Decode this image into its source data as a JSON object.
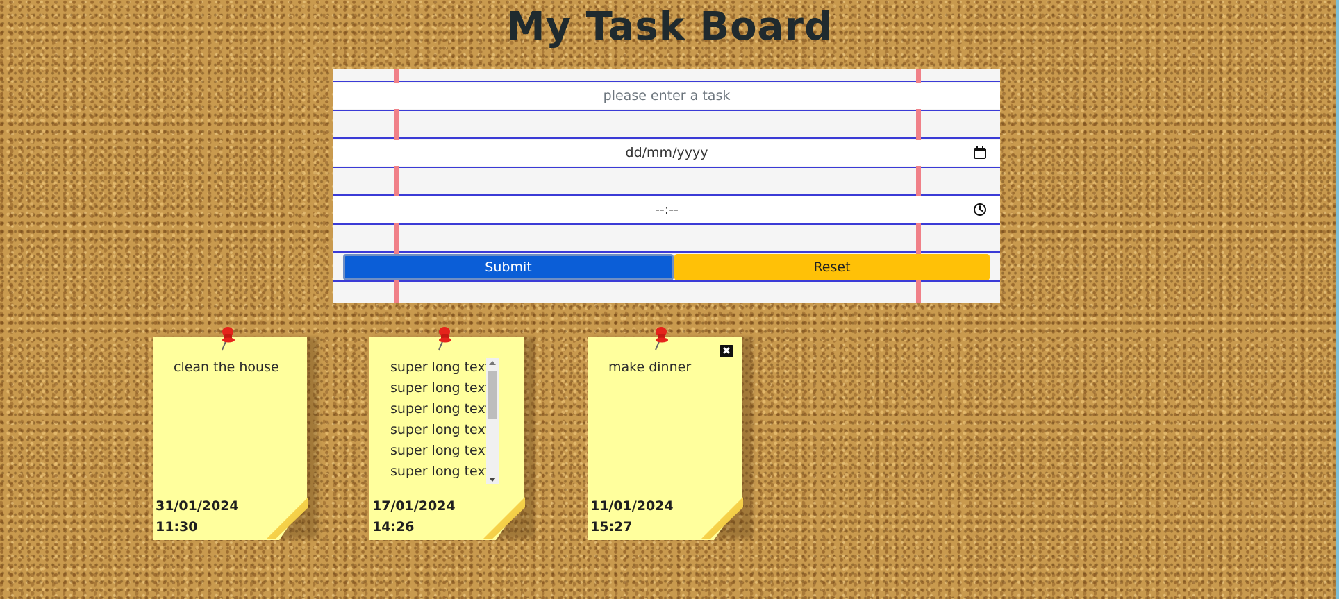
{
  "page": {
    "title": "My Task Board"
  },
  "form": {
    "task_placeholder": "please enter a task",
    "date_placeholder": "dd/mm/yyyy",
    "time_placeholder": "--:--",
    "submit_label": "Submit",
    "reset_label": "Reset",
    "date_icon": "calendar-icon",
    "time_icon": "clock-icon"
  },
  "notes": [
    {
      "text": "clean the house",
      "date": "31/01/2024",
      "time": "11:30"
    },
    {
      "lines": [
        "super long text",
        "super long text",
        "super long text",
        "super long text",
        "super long text",
        "super long text"
      ],
      "date": "17/01/2024",
      "time": "14:26"
    },
    {
      "text": "make dinner",
      "date": "11/01/2024",
      "time": "15:27",
      "close_icon": "close-icon"
    }
  ],
  "colors": {
    "submit": "#0b5ed7",
    "reset": "#ffc107",
    "note": "#ffff9d",
    "paper_rule": "#3b3bd6",
    "paper_margin": "#f08088"
  }
}
